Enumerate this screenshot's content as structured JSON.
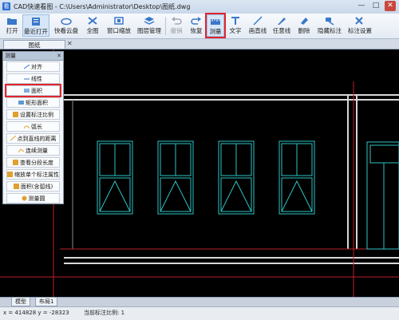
{
  "window": {
    "title": "CAD快速看图 - C:\\Users\\Administrator\\Desktop\\图纸.dwg",
    "app_icon_text": "看",
    "minimize": "—",
    "maximize": "□",
    "close": "✕"
  },
  "toolbar": {
    "items": [
      {
        "label": "打开",
        "icon": "folder-icon"
      },
      {
        "label": "最近打开",
        "icon": "recent-icon"
      },
      {
        "label": "快看云盘",
        "icon": "cloud-icon"
      },
      {
        "label": "全图",
        "icon": "fullview-icon"
      },
      {
        "label": "窗口缩放",
        "icon": "window-zoom-icon"
      },
      {
        "label": "图层管理",
        "icon": "layers-icon"
      },
      {
        "label": "撤销",
        "icon": "undo-icon"
      },
      {
        "label": "恢复",
        "icon": "redo-icon"
      },
      {
        "label": "测量",
        "icon": "measure-icon"
      },
      {
        "label": "文字",
        "icon": "text-icon"
      },
      {
        "label": "画直线",
        "icon": "line-icon"
      },
      {
        "label": "任意线",
        "icon": "pencil-icon"
      },
      {
        "label": "删除",
        "icon": "eraser-icon"
      },
      {
        "label": "隐藏标注",
        "icon": "hide-annotation-icon"
      },
      {
        "label": "标注设置",
        "icon": "annotation-settings-icon"
      }
    ]
  },
  "doc_tab": {
    "label": "图纸",
    "close": "✕"
  },
  "measure_panel": {
    "title": "测量",
    "close": "✕",
    "items": [
      {
        "label": "对齐"
      },
      {
        "label": "线性"
      },
      {
        "label": "面积"
      },
      {
        "label": "矩形面积"
      },
      {
        "label": "设置标注比例"
      },
      {
        "label": "弧长"
      },
      {
        "label": "点到直线的距离"
      },
      {
        "label": "连续测量"
      },
      {
        "label": "查看分段长度"
      },
      {
        "label": "缩放单个标注属性"
      },
      {
        "label": "面积(含弧线)"
      },
      {
        "label": "测量圆"
      }
    ]
  },
  "bottom_tabs": {
    "model": "模型",
    "layout1": "布局1"
  },
  "status": {
    "coords": "x = 414828  y = -28323",
    "scale": "当前标注比例: 1"
  },
  "colors": {
    "highlight": "#e0262c",
    "drawing_cyan": "#2ec4c4",
    "drawing_gray": "#d8d8d8",
    "drawing_red": "#c0202a"
  }
}
